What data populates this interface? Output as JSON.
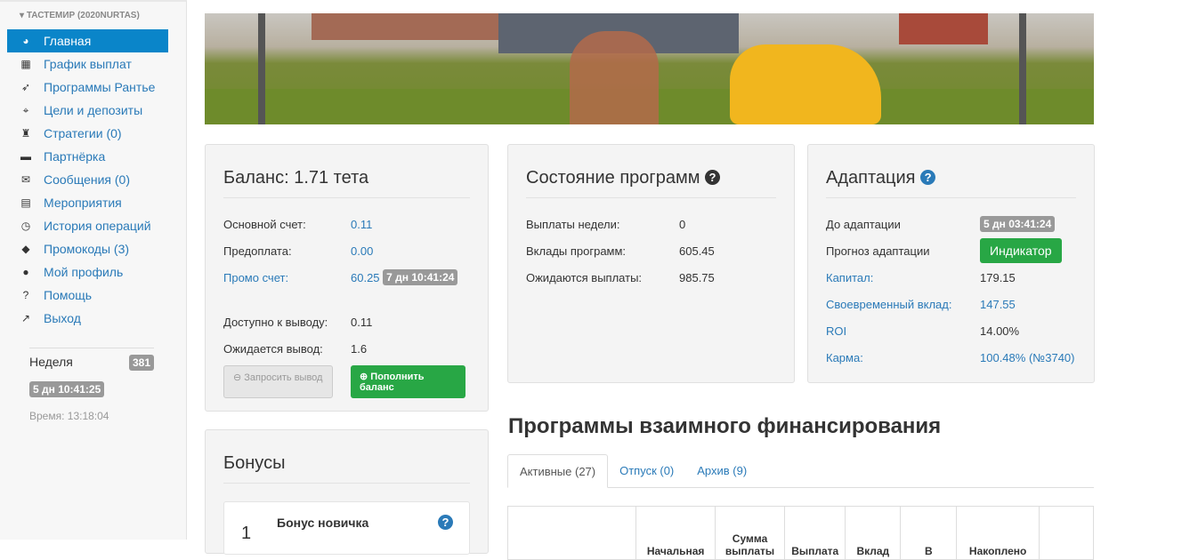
{
  "sidebar": {
    "user": "ТАСТЕМИР (2020NURTAS)",
    "items": [
      {
        "label": "Главная",
        "icon": "dashboard-icon",
        "glyph": "◕"
      },
      {
        "label": "График выплат",
        "icon": "calendar-icon",
        "glyph": "▦"
      },
      {
        "label": "Программы Рантье",
        "icon": "rocket-icon",
        "glyph": "➶"
      },
      {
        "label": "Цели и депозиты",
        "icon": "crosshairs-icon",
        "glyph": "⌖"
      },
      {
        "label": "Стратегии (0)",
        "icon": "chess-rook-icon",
        "glyph": "♜"
      },
      {
        "label": "Партнёрка",
        "icon": "briefcase-icon",
        "glyph": "▬"
      },
      {
        "label": "Сообщения (0)",
        "icon": "envelope-icon",
        "glyph": "✉"
      },
      {
        "label": "Мероприятия",
        "icon": "film-icon",
        "glyph": "▤"
      },
      {
        "label": "История операций",
        "icon": "clock-icon",
        "glyph": "◷"
      },
      {
        "label": "Промокоды (3)",
        "icon": "tag-icon",
        "glyph": "◆"
      },
      {
        "label": "Мой профиль",
        "icon": "user-icon",
        "glyph": "●"
      },
      {
        "label": "Помощь",
        "icon": "question-icon",
        "glyph": "?"
      },
      {
        "label": "Выход",
        "icon": "share-icon",
        "glyph": "↗"
      }
    ],
    "week_label": "Неделя",
    "week_value": "381",
    "week_timer": "5 дн 10:41:25",
    "time": "Время: 13:18:04"
  },
  "balance": {
    "title": "Баланс: 1.71 тета",
    "main_label": "Основной счет:",
    "main_value": "0.11",
    "prepay_label": "Предоплата:",
    "prepay_value": "0.00",
    "promo_label": "Промо счет:",
    "promo_value": "60.25",
    "promo_timer": "7 дн 10:41:24",
    "avail_label": "Доступно к выводу:",
    "avail_value": "0.11",
    "expected_label": "Ожидается вывод:",
    "expected_value": "1.6",
    "withdraw_btn": "Запросить вывод",
    "topup_btn": "Пополнить баланс"
  },
  "state": {
    "title": "Состояние программ",
    "rows": [
      {
        "label": "Выплаты недели:",
        "value": "0"
      },
      {
        "label": "Вклады программ:",
        "value": "605.45"
      },
      {
        "label": "Ожидаются выплаты:",
        "value": "985.75"
      }
    ]
  },
  "adapt": {
    "title": "Адаптация",
    "until_label": "До адаптации",
    "until_value": "5 дн 03:41:24",
    "forecast_label": "Прогноз адаптации",
    "forecast_btn": "Индикатор",
    "capital_label": "Капитал:",
    "capital_value": "179.15",
    "timely_label": "Своевременный вклад:",
    "timely_value": "147.55",
    "roi_label": "ROI",
    "roi_value": "14.00%",
    "karma_label": "Карма:",
    "karma_value": "100.48%",
    "karma_rank": "(№3740)"
  },
  "bonuses": {
    "title": "Бонусы",
    "item_num": "1",
    "item_title": "Бонус новичка"
  },
  "programs": {
    "title": "Программы взаимного финансирования",
    "tabs": [
      "Активные (27)",
      "Отпуск (0)",
      "Архив (9)"
    ],
    "columns": [
      "",
      "Начальная",
      "Сумма выплаты",
      "Выплата",
      "Вклад",
      "В",
      "Накоплено",
      ""
    ]
  }
}
